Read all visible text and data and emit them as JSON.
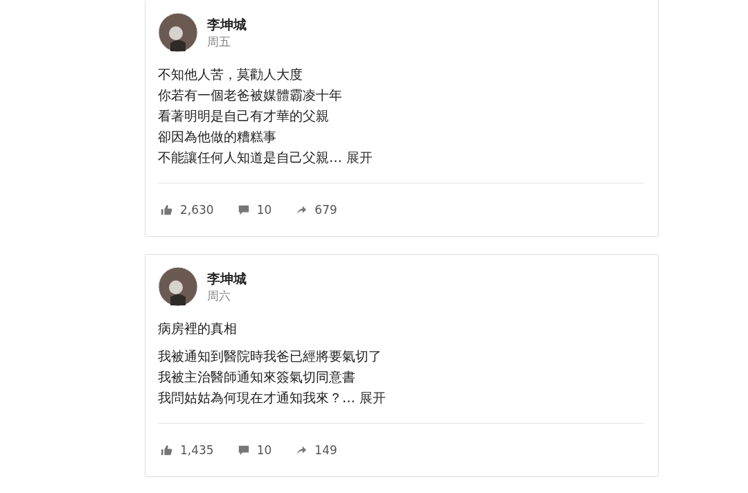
{
  "posts": [
    {
      "author": "李坤城",
      "date": "周五",
      "paragraphs": [
        [
          "不知他人苦，莫勸人大度",
          "你若有一個老爸被媒體霸凌十年",
          "看著明明是自己有才華的父親",
          "卻因為他做的糟糕事",
          "不能讓任何人知道是自己父親…"
        ]
      ],
      "expand": "展开",
      "likes": "2,630",
      "comments": "10",
      "shares": "679"
    },
    {
      "author": "李坤城",
      "date": "周六",
      "paragraphs": [
        [
          "病房裡的真相"
        ],
        [
          "我被通知到醫院時我爸已經將要氣切了",
          "我被主治醫師通知來簽氣切同意書",
          "我問姑姑為何現在才通知我來？…"
        ]
      ],
      "expand": "展开",
      "likes": "1,435",
      "comments": "10",
      "shares": "149"
    }
  ]
}
